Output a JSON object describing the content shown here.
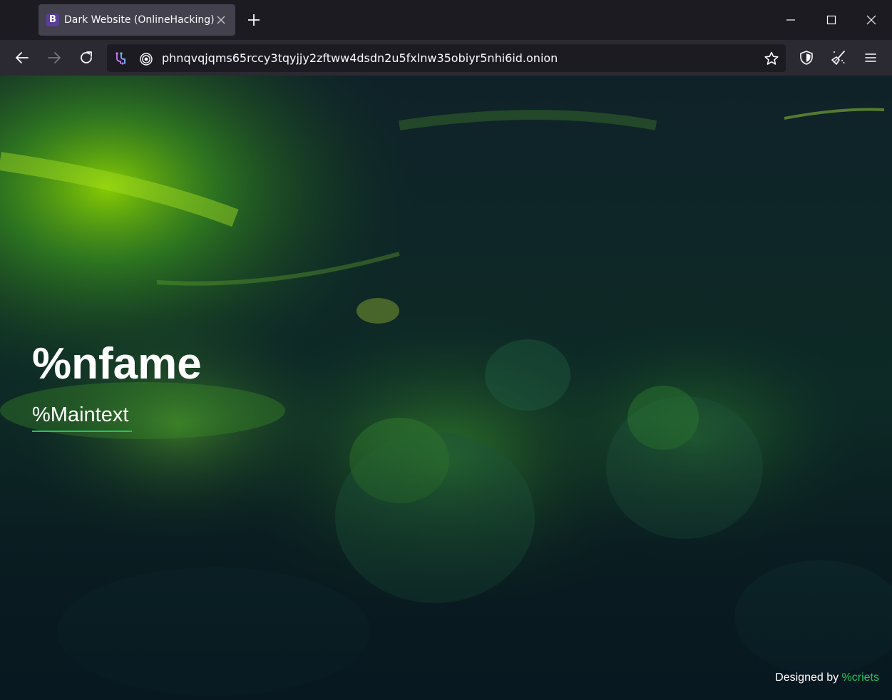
{
  "browser": {
    "tab": {
      "favicon_letter": "B",
      "title": "Dark Website (OnlineHacking)"
    },
    "address_bar": {
      "url": "phnqvqjqms65rccy3tqyjjy2zftww4dsdn2u5fxlnw35obiyr5nhi6id.onion"
    },
    "icons": {
      "tab_close": "close-icon",
      "new_tab": "plus-icon",
      "minimize": "minimize-icon",
      "maximize": "maximize-icon",
      "close": "close-icon",
      "back": "arrow-left-icon",
      "forward": "arrow-right-icon",
      "reload": "reload-icon",
      "circuit": "tor-circuit-icon",
      "onion": "onion-icon",
      "bookmark": "star-icon",
      "security": "shield-icon",
      "new_identity": "broom-icon",
      "menu": "hamburger-icon"
    }
  },
  "page": {
    "title": "%nfame",
    "maintext": "%Maintext",
    "footer": {
      "prefix": "Designed by ",
      "author": "%criets"
    }
  },
  "colors": {
    "accent": "#22c55e",
    "tab_bg": "#42414d",
    "toolbar_bg": "#2b2a33",
    "frame_bg": "#1c1b22"
  }
}
